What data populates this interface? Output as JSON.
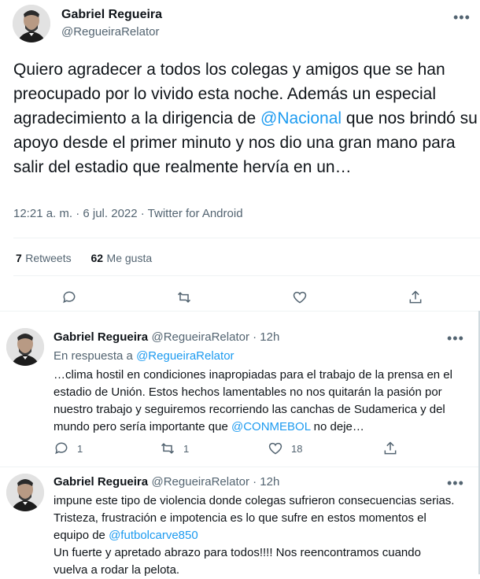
{
  "main": {
    "name": "Gabriel Regueira",
    "handle": "@RegueiraRelator",
    "text_before": "Quiero agradecer a todos los colegas y amigos que se han preocupado por lo vivido esta noche. Además un especial agradecimiento a la dirigencia de ",
    "mention": "@Nacional",
    "text_after": " que nos brindó su apoyo desde el primer minuto y nos dio una gran mano para salir del estadio que realmente hervía en un…",
    "timestamp": "12:21 a. m. · 6 jul. 2022 · Twitter for Android",
    "retweets_count": "7",
    "retweets_label": "Retweets",
    "likes_count": "62",
    "likes_label": "Me gusta",
    "more": "•••"
  },
  "replies": [
    {
      "name": "Gabriel Regueira",
      "handle_time": "@RegueiraRelator · 12h",
      "in_reply_prefix": "En respuesta a ",
      "in_reply_handle": "@RegueiraRelator",
      "text_before": "…clima hostil en condiciones inapropiadas para el trabajo de la prensa en el estadio de Unión.  Estos hechos lamentables no nos quitarán la pasión por nuestro trabajo y seguiremos recorriendo las canchas de Sudamerica y del mundo pero sería importante que ",
      "mention": "@CONMEBOL",
      "text_after": " no deje…",
      "reply_count": "1",
      "retweet_count": "1",
      "like_count": "18",
      "more": "•••"
    },
    {
      "name": "Gabriel Regueira",
      "handle_time": "@RegueiraRelator · 12h",
      "text_before": "impune este tipo de violencia donde colegas sufrieron consecuencias serias. Tristeza, frustración e impotencia es lo que sufre en estos momentos el equipo de ",
      "mention": "@futbolcarve850",
      "text_after": "Un fuerte y apretado abrazo para todos!!!! Nos reencontramos cuando vuelva a rodar la pelota.",
      "more": "•••"
    }
  ]
}
